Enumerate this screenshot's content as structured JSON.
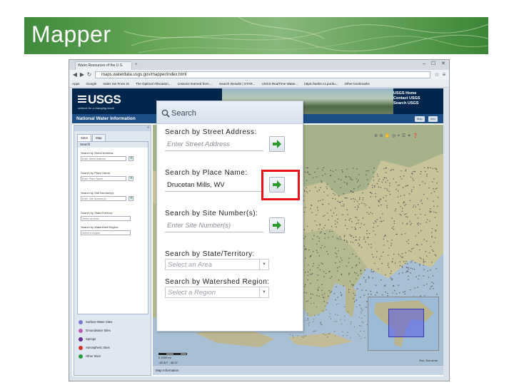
{
  "slide": {
    "title": "Mapper"
  },
  "browser": {
    "tab_title": "Water Resources of the U.S.",
    "new_tab": "+",
    "window_controls": "– ☐ ✕",
    "url": "maps.waterdata.usgs.gov/mapper/index.html",
    "bookmarks": [
      "Apps",
      "Google",
      "Index Ian From St",
      "The Optimal Allocation...",
      "Lessons learned from ...",
      "Search Results | STAR...",
      "USGS RealTime Water...",
      "https://webs.cs.purdu...",
      "Other bookmarks"
    ]
  },
  "header": {
    "logo": "USGS",
    "tagline": "science for a changing world",
    "links": [
      "USGS Home",
      "Contact USGS",
      "Search USGS"
    ],
    "site_title": "National Water Information",
    "buttons": [
      "Map",
      "Info"
    ]
  },
  "sidebar": {
    "collapse": "«",
    "tabs": [
      "Sites",
      "Map"
    ],
    "search_header": "Search",
    "fields": [
      {
        "label": "Search by Street Address:",
        "placeholder": "Enter Street Address"
      },
      {
        "label": "Search by Place Name:",
        "placeholder": "Enter Place Name"
      },
      {
        "label": "Search by Site Number(s):",
        "placeholder": "Enter Site Number(s)"
      },
      {
        "label": "Search by State/Territory:",
        "placeholder": "Select an Area"
      },
      {
        "label": "Search by Watershed Region:",
        "placeholder": "Select a Region"
      }
    ],
    "legend": [
      {
        "label": "Surface-Water Sites",
        "color": "#7b7bd6"
      },
      {
        "label": "Groundwater Sites",
        "color": "#c25bb5"
      },
      {
        "label": "Springs",
        "color": "#6a2c91"
      },
      {
        "label": "Atmospheric Sites",
        "color": "#d8332b"
      },
      {
        "label": "Other Sites",
        "color": "#2c9a3e"
      }
    ]
  },
  "map": {
    "corner_letter": "A",
    "toolbar_icons": [
      "zoom-in-icon",
      "zoom-out-icon",
      "pan-icon",
      "extent-icon",
      "locate-icon",
      "layers-icon",
      "tools-icon",
      "help-icon"
    ],
    "scale_labels": "0        1000 mi",
    "coords": "-45.927 , 38.07",
    "attribution": "Esri, DeLorme",
    "footer_label": "Map Information"
  },
  "callout": {
    "title": "Search",
    "street": {
      "label": "Search by Street Address:",
      "placeholder": "Enter Street Address"
    },
    "place": {
      "label": "Search by Place Name:",
      "value": "Drucetan Mills, WV"
    },
    "site": {
      "label": "Search by Site Number(s):",
      "placeholder": "Enter Site Number(s)"
    },
    "state": {
      "label": "Search by State/Territory:",
      "placeholder": "Select an Area"
    },
    "watershed": {
      "label": "Search by Watershed Region:",
      "placeholder": "Select a Region"
    }
  },
  "colors": {
    "highlight": "#e4141b",
    "go_arrow": "#2e9b2e",
    "usgs_navy": "#00264c"
  }
}
